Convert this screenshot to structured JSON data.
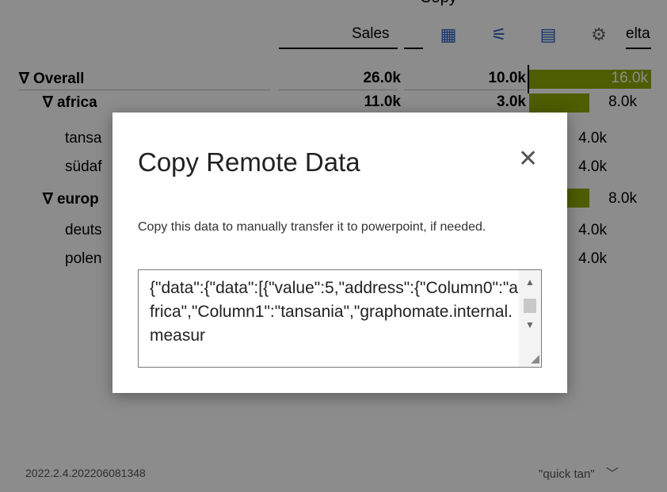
{
  "header": {
    "top_title": "Copy",
    "col_sales": "Sales",
    "col_delta": "elta",
    "icons": [
      "table-icon",
      "filter-icon",
      "excel-icon",
      "gear-icon"
    ]
  },
  "rows": [
    {
      "label": "∇ Overall",
      "v1": "26.0k",
      "v2": "10.0k",
      "bar_value": "16.0k",
      "level": 0,
      "bold": true
    },
    {
      "label": "∇ africa",
      "v1": "11.0k",
      "v2": "3.0k",
      "bar_value": "8.0k",
      "level": 1,
      "bold": true
    },
    {
      "label": "tansa",
      "bar_value": "4.0k",
      "level": 2,
      "bold": false
    },
    {
      "label": "südaf",
      "bar_value": "4.0k",
      "level": 2,
      "bold": false
    },
    {
      "label": "∇ europ",
      "bar_value": "8.0k",
      "level": 1,
      "bold": true
    },
    {
      "label": "deuts",
      "bar_value": "4.0k",
      "level": 2,
      "bold": false
    },
    {
      "label": "polen",
      "bar_value": "4.0k",
      "level": 2,
      "bold": false
    }
  ],
  "footer": {
    "version": "2022.2.4.202206081348",
    "selector": "\"quick tan\""
  },
  "modal": {
    "title": "Copy Remote Data",
    "description": "Copy this data to manually transfer it to powerpoint, if needed.",
    "textarea_value": "{\"data\":{\"data\":[{\"value\":5,\"address\":{\"Column0\":\"africa\",\"Column1\":\"tansania\",\"graphomate.internal.measur",
    "close_label": "✕"
  },
  "colors": {
    "bar": "#8faa00",
    "overlay": "rgba(0,0,0,0.45)"
  }
}
